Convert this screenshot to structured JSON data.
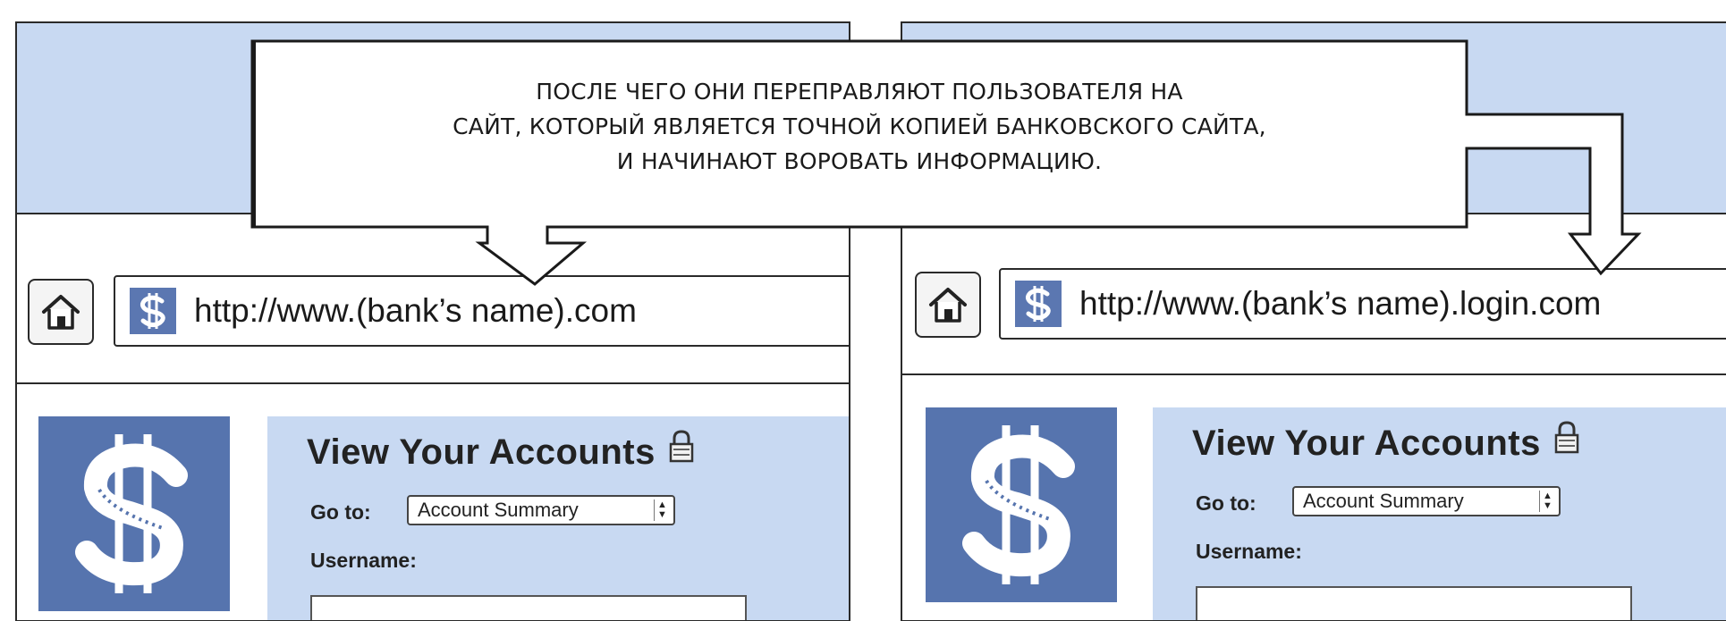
{
  "callout": {
    "lines": [
      "ПОСЛЕ ЧЕГО ОНИ ПЕРЕПРАВЛЯЮТ ПОЛЬЗОВАТЕЛЯ НА",
      "САЙТ, КОТОРЫЙ ЯВЛЯЕТСЯ ТОЧНОЙ КОПИЕЙ БАНКОВСКОГО САЙТА,",
      "И НАЧИНАЮТ ВОРОВАТЬ ИНФОРМАЦИЮ."
    ]
  },
  "left_browser": {
    "url": "http://www.(bank’s name).com",
    "login": {
      "title": "View Your Accounts",
      "goto_label": "Go to:",
      "goto_value": "Account Summary",
      "username_label": "Username:",
      "username_value": ""
    }
  },
  "right_browser": {
    "url": "http://www.(bank’s name).login.com",
    "login": {
      "title": "View Your Accounts",
      "goto_label": "Go to:",
      "goto_value": "Account Summary",
      "username_label": "Username:",
      "username_value": ""
    }
  },
  "icons": {
    "home": "home-icon",
    "site": "dollar-icon",
    "logo": "dollar-logo",
    "lock": "lock-icon",
    "select": "updown-arrows-icon"
  },
  "colors": {
    "band_blue": "#c8d9f2",
    "logo_blue": "#5674ae",
    "outline": "#2a2a2a"
  }
}
